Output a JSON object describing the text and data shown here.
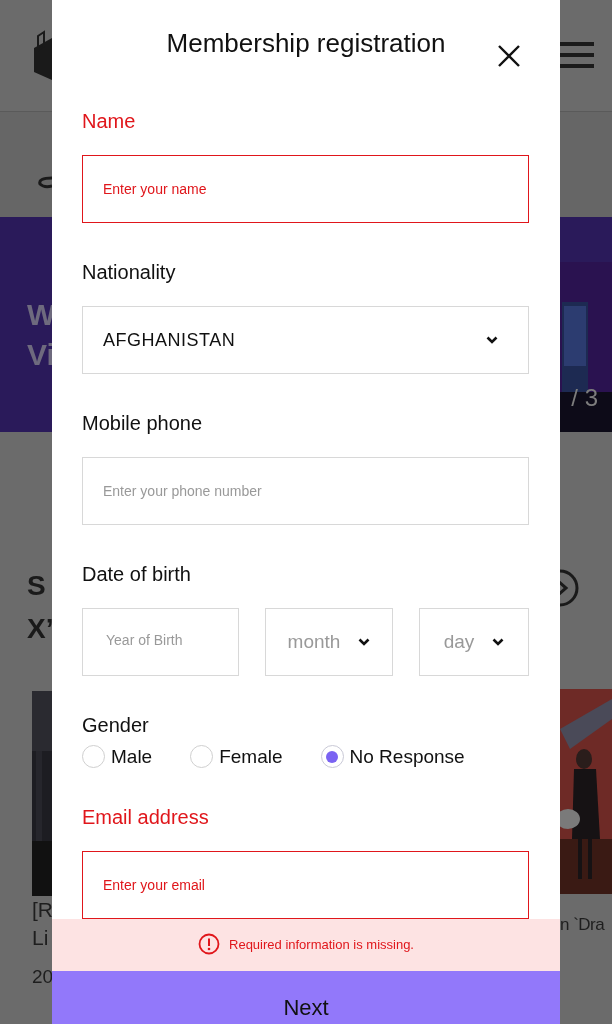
{
  "background": {
    "banner_text": [
      "W",
      "Vi"
    ],
    "slide_counter": "/ 3",
    "section_title": [
      "S",
      "X’"
    ],
    "left_caption": [
      "[R",
      "Li"
    ],
    "left_date": "20",
    "right_caption": "n `Dra"
  },
  "dialog": {
    "title": "Membership registration",
    "fields": [
      {
        "kind": "text",
        "label": "Name",
        "placeholder": "Enter your name",
        "error": true
      },
      {
        "kind": "select",
        "label": "Nationality",
        "value": "AFGHANISTAN",
        "error": false
      },
      {
        "kind": "text",
        "label": "Mobile phone",
        "placeholder": "Enter your phone number",
        "error": false
      },
      {
        "kind": "date",
        "label": "Date of birth",
        "year_placeholder": "Year of Birth",
        "month": "month",
        "day": "day",
        "error": false
      },
      {
        "kind": "radio",
        "label": "Gender",
        "error": false,
        "options": [
          {
            "label": "Male",
            "selected": false
          },
          {
            "label": "Female",
            "selected": false
          },
          {
            "label": "No Response",
            "selected": true
          }
        ]
      },
      {
        "kind": "text",
        "label": "Email address",
        "placeholder": "Enter your email",
        "error": true
      }
    ],
    "alert": "Required information is missing.",
    "next_button": "Next"
  }
}
